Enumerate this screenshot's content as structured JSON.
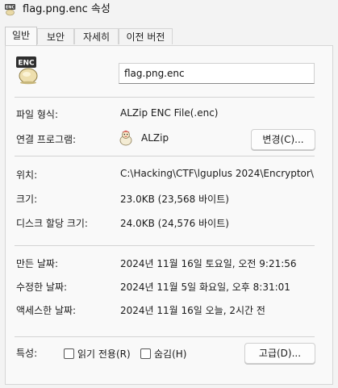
{
  "window": {
    "title": "flag.png.enc 속성"
  },
  "tabs": [
    {
      "label": "일반",
      "active": true
    },
    {
      "label": "보안",
      "active": false
    },
    {
      "label": "자세히",
      "active": false
    },
    {
      "label": "이전 버전",
      "active": false
    }
  ],
  "file": {
    "name": "flag.png.enc",
    "icon_badge": "ENC"
  },
  "rows": {
    "type_label": "파일 형식:",
    "type_value": "ALZip ENC File(.enc)",
    "opens_label": "연결 프로그램:",
    "opens_value": "ALZip",
    "change_button": "변경(C)...",
    "location_label": "위치:",
    "location_value": "C:\\Hacking\\CTF\\lguplus 2024\\Encryptor\\",
    "size_label": "크기:",
    "size_value": "23.0KB (23,568 바이트)",
    "disk_label": "디스크 할당 크기:",
    "disk_value": "24.0KB (24,576 바이트)",
    "created_label": "만든 날짜:",
    "created_value": "2024년 11월 16일 토요일, 오전 9:21:56",
    "modified_label": "수정한 날짜:",
    "modified_value": "2024년 11월 5일 화요일, 오후 8:31:01",
    "accessed_label": "액세스한 날짜:",
    "accessed_value": "2024년 11월 16일 오늘, 2시간 전",
    "attributes_label": "특성:",
    "readonly_label": "읽기 전용(R)",
    "hidden_label": "숨김(H)",
    "advanced_button": "고급(D)..."
  },
  "attributes": {
    "readonly": false,
    "hidden": false
  },
  "colors": {
    "panel_bg": "#f9f9f9",
    "window_bg": "#f3f3f3",
    "separator": "#d3d3d3"
  }
}
